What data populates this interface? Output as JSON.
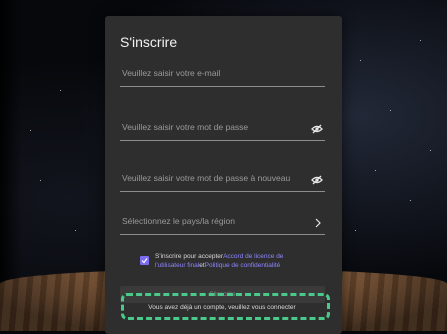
{
  "form": {
    "title": "S'inscrire",
    "email_placeholder": "Veuillez saisir votre e-mail",
    "password_placeholder": "Veuillez saisir votre mot de passe",
    "password_confirm_placeholder": "Veuillez saisir votre mot de passe à nouveau",
    "country_placeholder": "Sélectionnez le pays/la région",
    "terms_prefix": "S'inscrire pour accepter",
    "terms_link_1": "Accord de licence de l'utilisateur final",
    "terms_joiner": "et",
    "terms_link_2": "Politique de confidentialité",
    "submit_label": "S'inscrire",
    "login_prompt": "Vous avez déjà un compte, veuillez vous connecter",
    "terms_checked": true
  },
  "icons": {
    "password_toggle": "eye-slash-icon",
    "password_confirm_toggle": "eye-slash-icon",
    "country_chevron": "chevron-right-icon"
  },
  "colors": {
    "accent": "#7b6cf0",
    "link": "#8e86ff",
    "highlight": "#49c98a",
    "panel": "#2e2e2e"
  }
}
